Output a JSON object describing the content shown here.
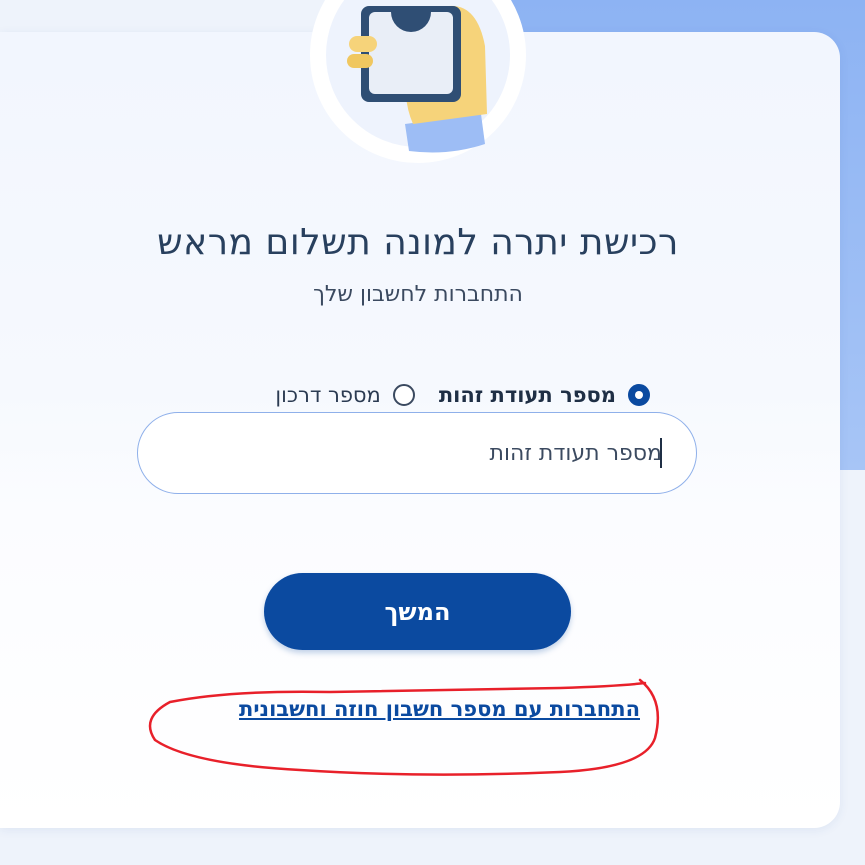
{
  "page": {
    "title": "רכישת יתרה למונה תשלום מראש",
    "subtitle": "התחברות לחשבון שלך"
  },
  "login_method": {
    "options": [
      {
        "label": "מספר תעודת זהות",
        "selected": true
      },
      {
        "label": "מספר דרכון",
        "selected": false
      }
    ]
  },
  "id_input": {
    "placeholder": "מספר תעודת זהות",
    "value": ""
  },
  "continue_button": {
    "label": "המשך"
  },
  "alt_login_link": {
    "label": "התחברות עם מספר חשבון חוזה וחשבונית"
  },
  "colors": {
    "primary": "#0b4aa0",
    "background_accent": "#8db3f3",
    "annotation_circle": "#e8202a"
  },
  "icons": {
    "illustration": "hand-holding-phone-icon"
  }
}
